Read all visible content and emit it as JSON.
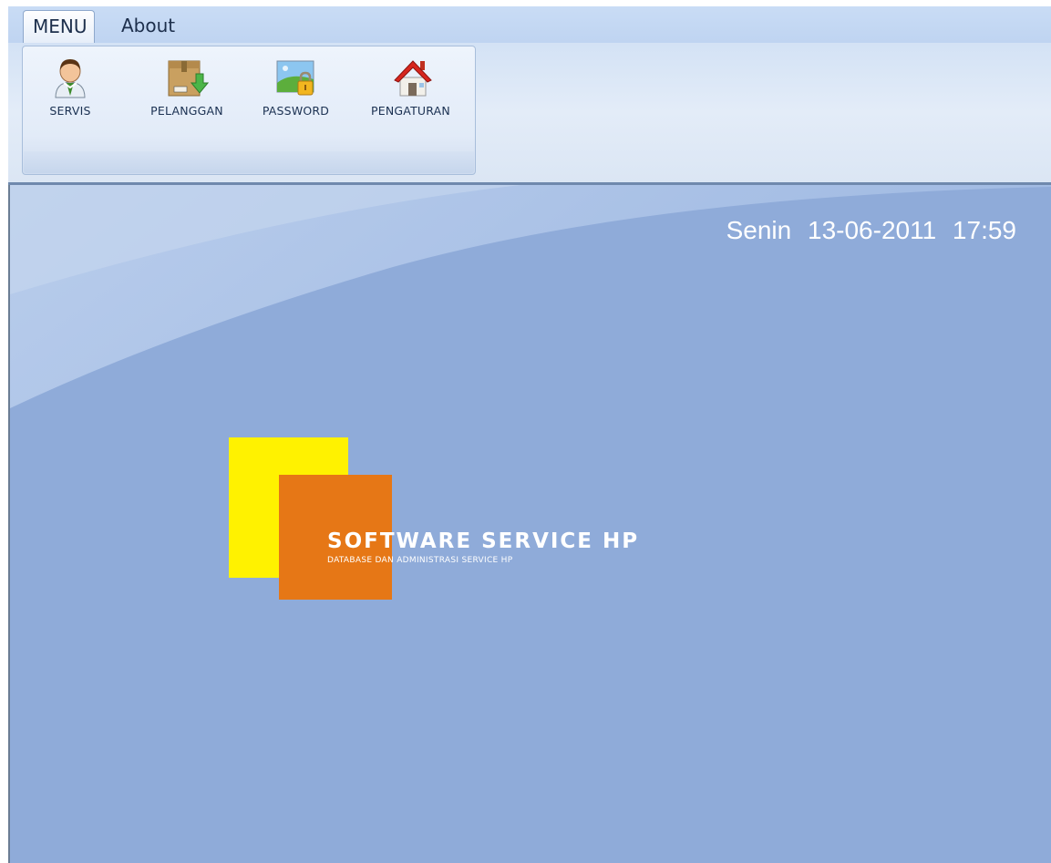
{
  "ribbon": {
    "tabs": [
      {
        "label": "MENU",
        "active": true
      },
      {
        "label": "About",
        "active": false
      }
    ],
    "buttons": [
      {
        "label": "SERVIS",
        "icon": "user-icon"
      },
      {
        "label": "PELANGGAN",
        "icon": "box-download-icon"
      },
      {
        "label": "PASSWORD",
        "icon": "lock-picture-icon"
      },
      {
        "label": "PENGATURAN",
        "icon": "house-icon"
      }
    ]
  },
  "main": {
    "datetime": "Senin  13-06-2011  17:59",
    "logo": {
      "title": "SOFTWARE SERVICE HP",
      "subtitle": "DATABASE DAN ADMINISTRASI SERVICE HP"
    }
  },
  "colors": {
    "main_bg": "#8fabd9",
    "logo_yellow": "#fff200",
    "logo_orange": "#e67716"
  }
}
